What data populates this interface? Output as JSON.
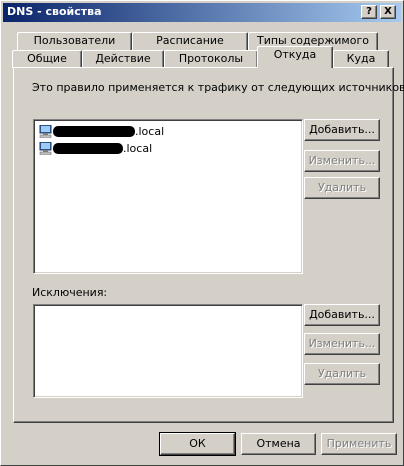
{
  "window": {
    "title": "DNS - свойства",
    "help_button": "?",
    "close_button": "X"
  },
  "tabs_row1": [
    {
      "label": "Пользователи"
    },
    {
      "label": "Расписание"
    },
    {
      "label": "Типы содержимого"
    }
  ],
  "tabs_row2": [
    {
      "label": "Общие"
    },
    {
      "label": "Действие"
    },
    {
      "label": "Протоколы"
    },
    {
      "label": "Откуда",
      "active": true
    },
    {
      "label": "Куда"
    }
  ],
  "sources": {
    "caption": "Это правило применяется к трафику от следующих источников:",
    "items": [
      {
        "suffix": ".local",
        "icon": "computer-icon"
      },
      {
        "suffix": ".local",
        "icon": "computer-icon"
      }
    ],
    "add_label": "Добавить...",
    "edit_label": "Изменить...",
    "delete_label": "Удалить"
  },
  "exceptions": {
    "caption": "Исключения:",
    "add_label": "Добавить...",
    "edit_label": "Изменить...",
    "delete_label": "Удалить"
  },
  "footer": {
    "ok_label": "ОК",
    "cancel_label": "Отмена",
    "apply_label": "Применить"
  },
  "colors": {
    "face": "#d4d0c8",
    "title_start": "#0a246a",
    "title_end": "#a6caf0",
    "disabled_text": "#808080"
  }
}
